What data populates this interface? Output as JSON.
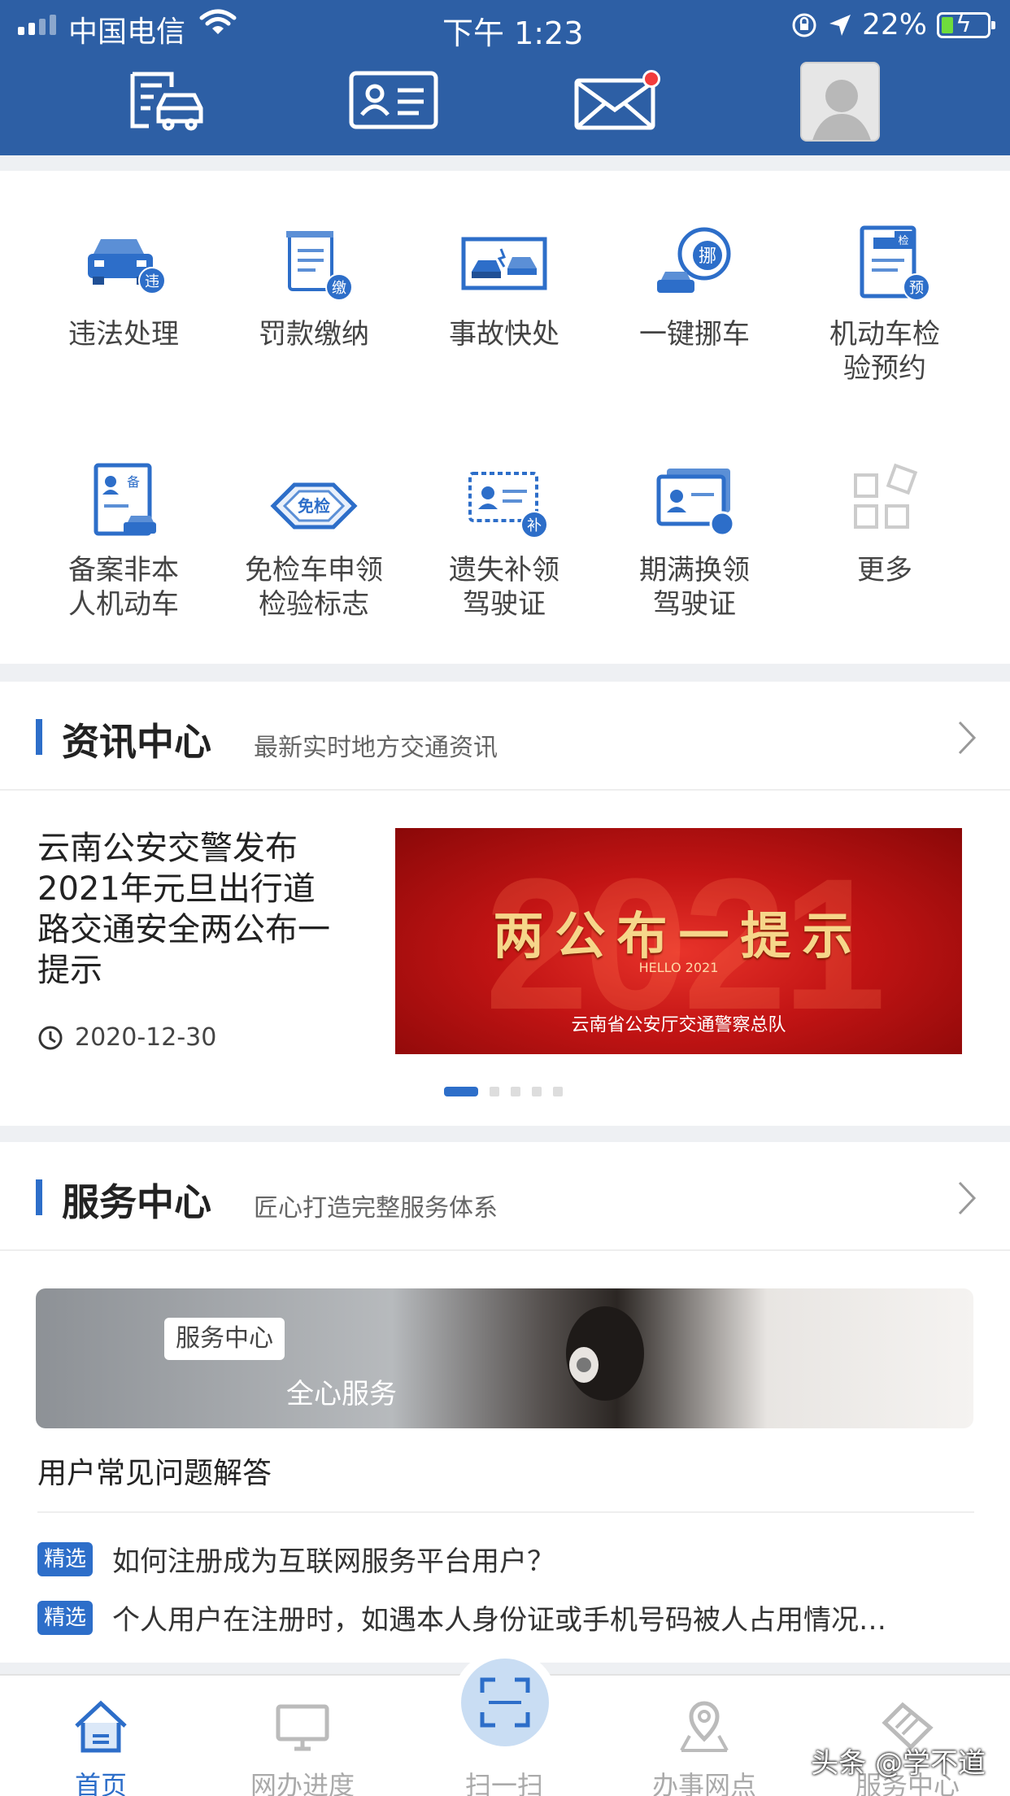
{
  "status_bar": {
    "carrier": "中国电信",
    "time": "下午 1:23",
    "battery": "22%",
    "battery_level": 0.22
  },
  "colors": {
    "brand_blue": "#2d5fa5",
    "accent": "#2d6ec9",
    "banner_red": "#c21414",
    "badge_red": "#f23c3c"
  },
  "top_bar": {
    "icons": [
      "vehicle-list-icon",
      "id-card-icon",
      "mail-icon",
      "avatar"
    ],
    "mail_has_notification": true
  },
  "services": [
    {
      "label": "违法处理",
      "icon": "violation-car-icon",
      "badge": "违"
    },
    {
      "label": "罚款缴纳",
      "icon": "fine-payment-icon",
      "badge": "缴"
    },
    {
      "label": "事故快处",
      "icon": "accident-icon",
      "badge": ""
    },
    {
      "label": "一键挪车",
      "icon": "move-car-icon",
      "badge": "挪"
    },
    {
      "label": "机动车检\n验预约",
      "icon": "inspection-booking-icon",
      "badge": "预"
    },
    {
      "label": "备案非本\n人机动车",
      "icon": "register-vehicle-icon",
      "badge": "备"
    },
    {
      "label": "免检车申领\n检验标志",
      "icon": "exempt-inspection-icon",
      "badge": "免检"
    },
    {
      "label": "遗失补领\n驾驶证",
      "icon": "lost-license-icon",
      "badge": "补"
    },
    {
      "label": "期满换领\n驾驶证",
      "icon": "renew-license-icon",
      "badge": ""
    },
    {
      "label": "更多",
      "icon": "more-grid-icon",
      "badge": ""
    }
  ],
  "news": {
    "title": "资讯中心",
    "subtitle": "最新实时地方交通资讯",
    "article_title": "云南公安交警发布2021年元旦出行道路交通安全两公布一提示",
    "article_date": "2020-12-30",
    "banner": {
      "year": "2021",
      "headline": "两公布一提示",
      "hello": "HELLO 2021",
      "org": "云南省公安厅交通警察总队"
    },
    "carousel_count": 5,
    "carousel_active": 1
  },
  "service_center": {
    "title": "服务中心",
    "subtitle": "匠心打造完整服务体系",
    "banner_tag": "服务中心",
    "banner_slogan": "全心服务",
    "faq_title": "用户常见问题解答",
    "faq": [
      {
        "tag": "精选",
        "text": "如何注册成为互联网服务平台用户？"
      },
      {
        "tag": "精选",
        "text": "个人用户在注册时，如遇本人身份证或手机号码被人占用情况…"
      }
    ]
  },
  "bottom_nav": [
    {
      "label": "首页",
      "icon": "home-icon",
      "active": true
    },
    {
      "label": "网办进度",
      "icon": "monitor-icon",
      "active": false
    },
    {
      "label": "扫一扫",
      "icon": "scan-icon",
      "active": false
    },
    {
      "label": "办事网点",
      "icon": "location-pin-icon",
      "active": false
    },
    {
      "label": "服务中心",
      "icon": "service-handshake-icon",
      "active": false
    }
  ],
  "watermark": "头条 @学不道"
}
